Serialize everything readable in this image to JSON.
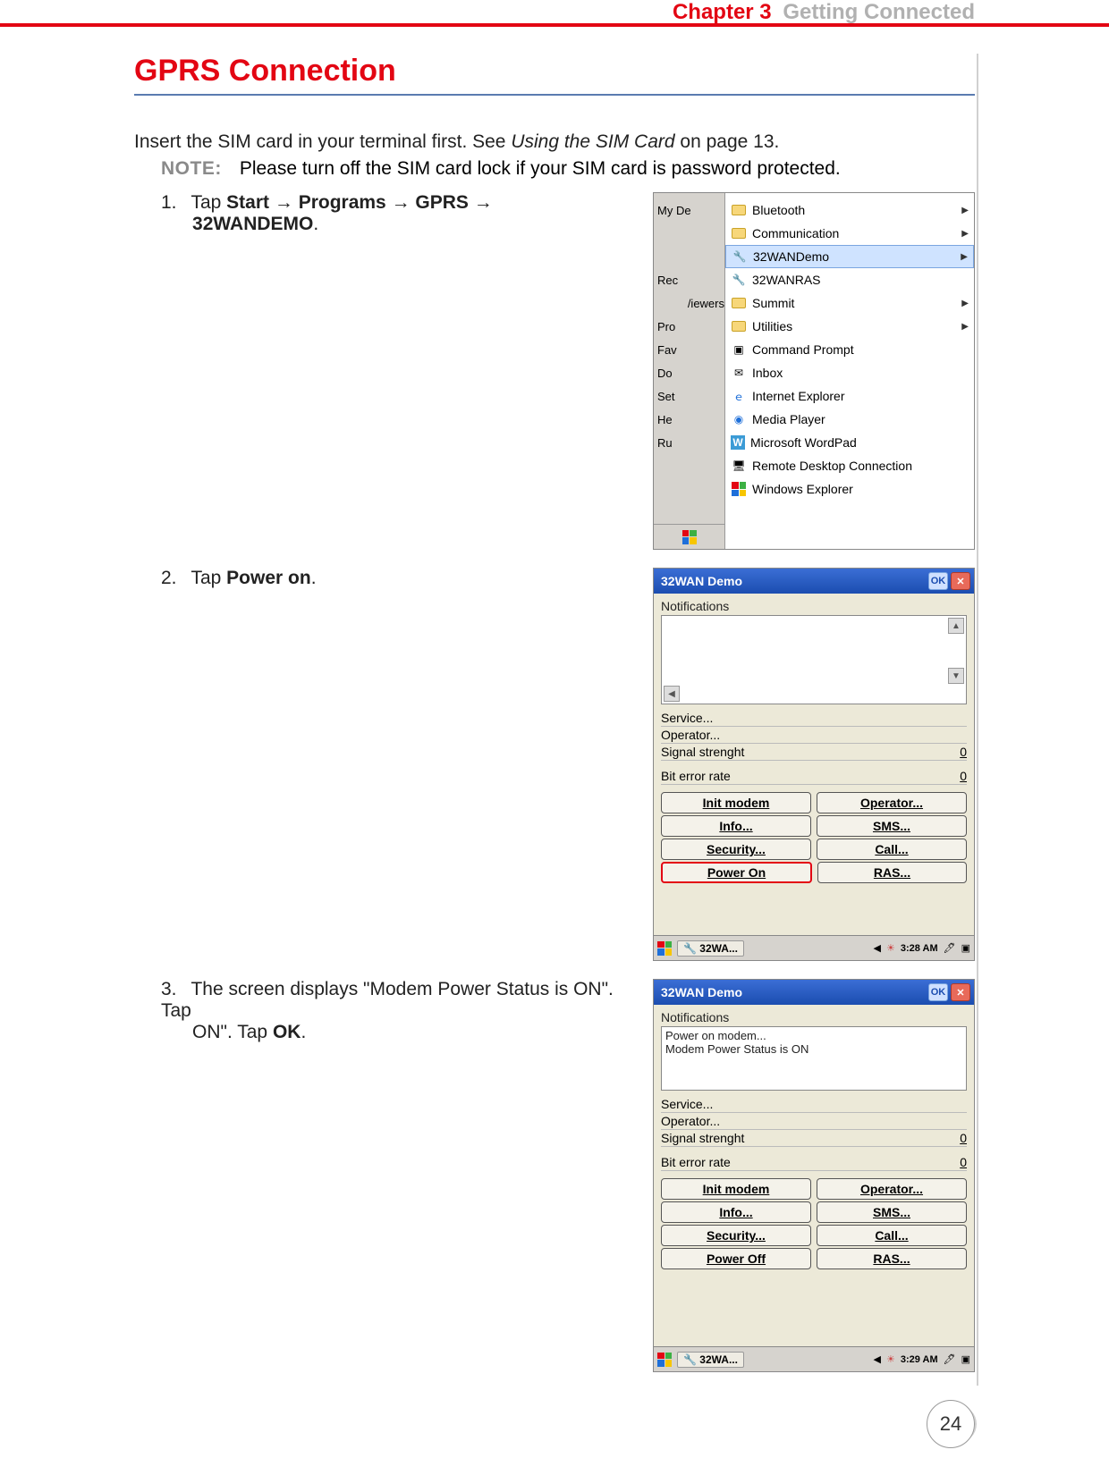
{
  "header": {
    "chapter": "Chapter 3",
    "title": "Getting Connected"
  },
  "section_title": "GPRS Connection",
  "intro": {
    "prefix": "Insert the SIM card in your terminal first. See ",
    "link": "Using the SIM Card",
    "suffix": " on page 13."
  },
  "note": {
    "label": "NOTE:",
    "text": "Please turn off the SIM card lock if your SIM card is password protected."
  },
  "steps": {
    "s1": {
      "num": "1.",
      "t0": "Tap ",
      "start": "Start",
      "arr": " → ",
      "programs": "Programs",
      "gprs": "GPRS",
      "demo": "32WANDEMO",
      "period": "."
    },
    "s2": {
      "num": "2.",
      "t0": "Tap ",
      "b": "Power on",
      "period": "."
    },
    "s3": {
      "num": "3.",
      "t0": "The screen displays \"Modem Power Status is ON\". Tap ",
      "b": "OK",
      "period": "."
    }
  },
  "shot1": {
    "left": [
      "My De",
      "",
      "",
      "Rec",
      "",
      "Pro",
      "Fav",
      "Do",
      "Set",
      "He",
      "Ru"
    ],
    "left_extra": "/iewers",
    "menu": [
      {
        "label": "Bluetooth",
        "arrow": true,
        "icon": "folder"
      },
      {
        "label": "Communication",
        "arrow": true,
        "icon": "folder"
      },
      {
        "label": "32WANDemo",
        "arrow": true,
        "icon": "app",
        "hl": true
      },
      {
        "label": "32WANRAS",
        "arrow": false,
        "icon": "app"
      },
      {
        "label": "Summit",
        "arrow": true,
        "icon": "folder"
      },
      {
        "label": "Utilities",
        "arrow": true,
        "icon": "folder"
      },
      {
        "label": "Command Prompt",
        "arrow": false,
        "icon": "cmd"
      },
      {
        "label": "Inbox",
        "arrow": false,
        "icon": "mail"
      },
      {
        "label": "Internet Explorer",
        "arrow": false,
        "icon": "ie"
      },
      {
        "label": "Media Player",
        "arrow": false,
        "icon": "mp"
      },
      {
        "label": "Microsoft WordPad",
        "arrow": false,
        "icon": "word"
      },
      {
        "label": "Remote Desktop Connection",
        "arrow": false,
        "icon": "rdp"
      },
      {
        "label": "Windows Explorer",
        "arrow": false,
        "icon": "flag"
      }
    ]
  },
  "shot2": {
    "title": "32WAN Demo",
    "ok": "OK",
    "notif_label": "Notifications",
    "notif_lines": [],
    "stats": {
      "service": "Service...",
      "operator": "Operator...",
      "signal_label": "Signal strenght",
      "signal_val": "0",
      "ber_label": "Bit error rate",
      "ber_val": "0"
    },
    "buttons": [
      [
        "Init modem",
        "Operator..."
      ],
      [
        "Info...",
        "SMS..."
      ],
      [
        "Security...",
        "Call..."
      ],
      [
        "Power On",
        "RAS..."
      ]
    ],
    "hl_button": "Power On",
    "taskbar": {
      "app": "32WA...",
      "time": "3:28 AM"
    }
  },
  "shot3": {
    "title": "32WAN Demo",
    "ok": "OK",
    "notif_label": "Notifications",
    "notif_lines": [
      "Power on modem...",
      "Modem Power Status is ON"
    ],
    "stats": {
      "service": "Service...",
      "operator": "Operator...",
      "signal_label": "Signal strenght",
      "signal_val": "0",
      "ber_label": "Bit error rate",
      "ber_val": "0"
    },
    "buttons": [
      [
        "Init modem",
        "Operator..."
      ],
      [
        "Info...",
        "SMS..."
      ],
      [
        "Security...",
        "Call..."
      ],
      [
        "Power Off",
        "RAS..."
      ]
    ],
    "hl_button": "",
    "taskbar": {
      "app": "32WA...",
      "time": "3:29 AM"
    }
  },
  "page_number": "24"
}
